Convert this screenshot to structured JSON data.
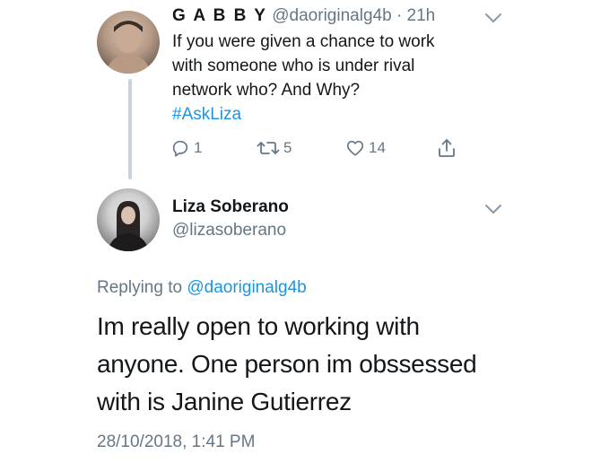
{
  "tweet1": {
    "display_name": "G A B B Y",
    "handle": "@daoriginalg4b",
    "separator": "·",
    "time": "21h",
    "text_lines": [
      "If you were given a chance to work",
      "with someone who is under rival",
      "network who? And Why?"
    ],
    "hashtag": "#AskLiza",
    "reply_count": "1",
    "retweet_count": "5",
    "like_count": "14",
    "icons": {
      "avatar": "avatar",
      "menu": "chevron-down-icon",
      "reply": "reply-icon",
      "retweet": "retweet-icon",
      "like": "heart-icon",
      "share": "share-icon"
    }
  },
  "tweet2": {
    "display_name": "Liza Soberano",
    "handle": "@lizasoberano",
    "replying_prefix": "Replying to",
    "replying_to": "@daoriginalg4b",
    "text_lines": [
      "Im really open to working with",
      "anyone. One person im obssessed",
      "with is Janine Gutierrez"
    ],
    "timestamp": "28/10/2018, 1:41 PM",
    "icons": {
      "avatar": "avatar",
      "menu": "chevron-down-icon"
    }
  },
  "colors": {
    "text": "#14171a",
    "secondary": "#657786",
    "link": "#1b95e0",
    "thread_line": "#c9d3db"
  }
}
